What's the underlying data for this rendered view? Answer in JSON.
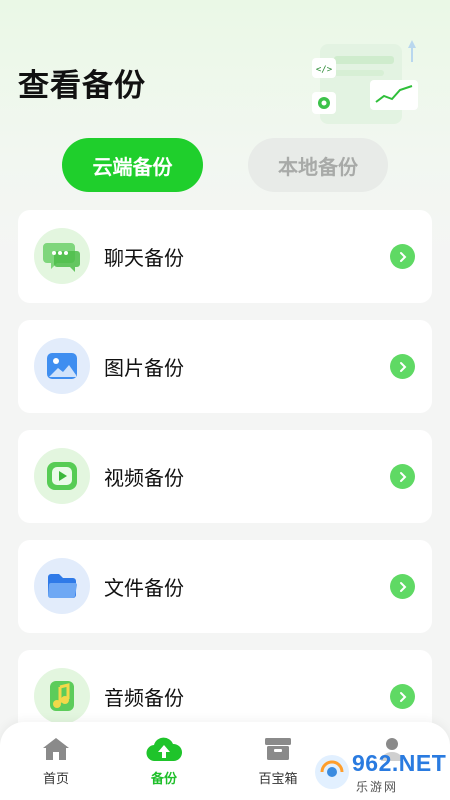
{
  "page": {
    "title": "查看备份"
  },
  "tabs": {
    "cloud": "云端备份",
    "local": "本地备份"
  },
  "items": [
    {
      "label": "聊天备份",
      "icon": "chat-icon"
    },
    {
      "label": "图片备份",
      "icon": "image-icon"
    },
    {
      "label": "视频备份",
      "icon": "video-icon"
    },
    {
      "label": "文件备份",
      "icon": "folder-icon"
    },
    {
      "label": "音频备份",
      "icon": "music-icon"
    }
  ],
  "tabbar": {
    "items": [
      {
        "label": "首页",
        "icon": "home-icon"
      },
      {
        "label": "备份",
        "icon": "cloud-upload-icon"
      },
      {
        "label": "百宝箱",
        "icon": "box-icon"
      },
      {
        "label": "",
        "icon": "user-icon"
      }
    ]
  },
  "watermark": {
    "text": "962.NET",
    "sub": "乐游网"
  },
  "colors": {
    "accent": "#1fcf2c",
    "arrow": "#5fd964",
    "background": "#f4f5f4"
  }
}
